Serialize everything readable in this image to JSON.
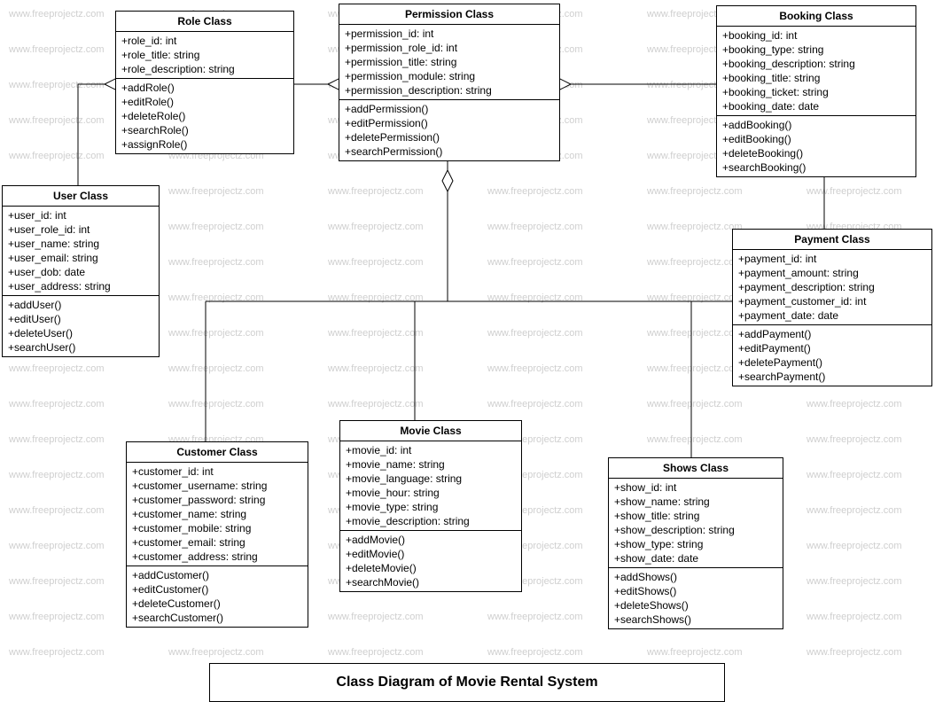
{
  "diagram_title": "Class Diagram of Movie Rental System",
  "watermark_text": "www.freeprojectz.com",
  "classes": {
    "role": {
      "title": "Role Class",
      "attrs": [
        "+role_id: int",
        "+role_title: string",
        "+role_description: string"
      ],
      "ops": [
        "+addRole()",
        "+editRole()",
        "+deleteRole()",
        "+searchRole()",
        "+assignRole()"
      ]
    },
    "permission": {
      "title": "Permission Class",
      "attrs": [
        "+permission_id: int",
        "+permission_role_id: int",
        "+permission_title: string",
        "+permission_module: string",
        "+permission_description: string"
      ],
      "ops": [
        "+addPermission()",
        "+editPermission()",
        "+deletePermission()",
        "+searchPermission()"
      ]
    },
    "booking": {
      "title": "Booking Class",
      "attrs": [
        "+booking_id: int",
        "+booking_type: string",
        "+booking_description: string",
        "+booking_title: string",
        "+booking_ticket: string",
        "+booking_date: date"
      ],
      "ops": [
        "+addBooking()",
        "+editBooking()",
        "+deleteBooking()",
        "+searchBooking()"
      ]
    },
    "user": {
      "title": "User Class",
      "attrs": [
        "+user_id: int",
        "+user_role_id: int",
        "+user_name: string",
        "+user_email: string",
        "+user_dob: date",
        "+user_address: string"
      ],
      "ops": [
        "+addUser()",
        "+editUser()",
        "+deleteUser()",
        "+searchUser()"
      ]
    },
    "payment": {
      "title": "Payment Class",
      "attrs": [
        "+payment_id: int",
        "+payment_amount: string",
        "+payment_description: string",
        "+payment_customer_id: int",
        "+payment_date: date"
      ],
      "ops": [
        "+addPayment()",
        "+editPayment()",
        "+deletePayment()",
        "+searchPayment()"
      ]
    },
    "customer": {
      "title": "Customer Class",
      "attrs": [
        "+customer_id: int",
        "+customer_username: string",
        "+customer_password: string",
        "+customer_name: string",
        "+customer_mobile: string",
        "+customer_email: string",
        "+customer_address: string"
      ],
      "ops": [
        "+addCustomer()",
        "+editCustomer()",
        "+deleteCustomer()",
        "+searchCustomer()"
      ]
    },
    "movie": {
      "title": "Movie  Class",
      "attrs": [
        "+movie_id: int",
        "+movie_name: string",
        "+movie_language: string",
        "+movie_hour: string",
        "+movie_type: string",
        "+movie_description: string"
      ],
      "ops": [
        "+addMovie()",
        "+editMovie()",
        "+deleteMovie()",
        "+searchMovie()"
      ]
    },
    "shows": {
      "title": "Shows Class",
      "attrs": [
        "+show_id: int",
        "+show_name: string",
        "+show_title: string",
        "+show_description: string",
        "+show_type: string",
        "+show_date: date"
      ],
      "ops": [
        "+addShows()",
        "+editShows()",
        "+deleteShows()",
        "+searchShows()"
      ]
    }
  }
}
